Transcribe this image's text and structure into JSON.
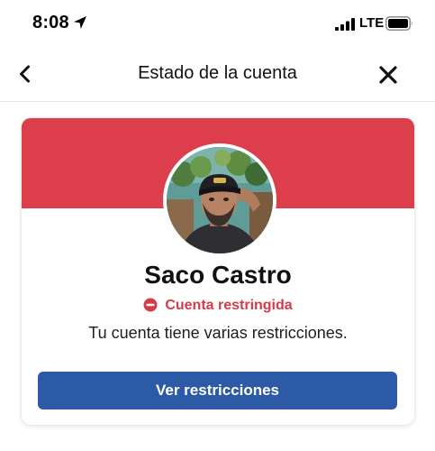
{
  "status_bar": {
    "time": "8:08",
    "network": "LTE"
  },
  "header": {
    "title": "Estado de la cuenta"
  },
  "account": {
    "name": "Saco Castro",
    "status_label": "Cuenta restringida",
    "description": "Tu cuenta tiene varias restricciones.",
    "action_label": "Ver restricciones"
  },
  "colors": {
    "banner": "#dd3e4c",
    "status": "#d63a48",
    "button": "#2d5aa7"
  },
  "icons": {
    "back": "chevron-left",
    "close": "x-mark",
    "status": "minus-circle",
    "location": "location-arrow",
    "signal": "signal-bars",
    "battery": "battery"
  }
}
